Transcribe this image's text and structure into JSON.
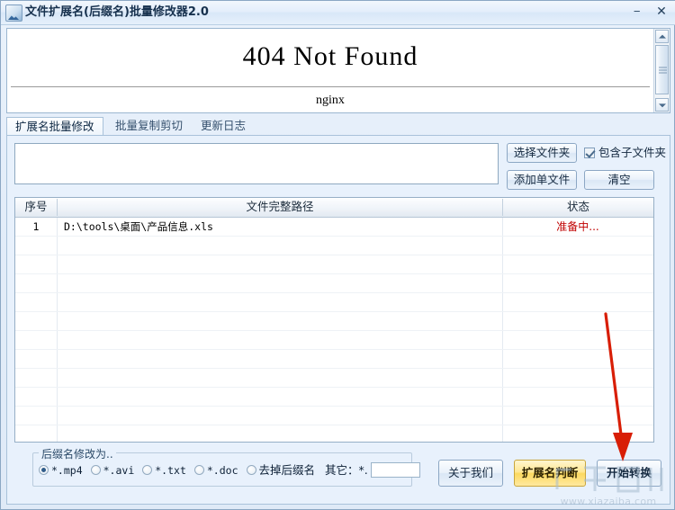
{
  "window": {
    "title": "文件扩展名(后缀名)批量修改器2.0",
    "icon": "picture-icon",
    "minimize_label": "−",
    "close_label": "✕"
  },
  "browser": {
    "heading": "404 Not Found",
    "server": "nginx",
    "scroll_up": "▲",
    "scroll_down": "▼"
  },
  "tabs": [
    {
      "label": "扩展名批量修改",
      "active": true
    },
    {
      "label": "批量复制剪切",
      "active": false
    },
    {
      "label": "更新日志",
      "active": false
    }
  ],
  "toolbar": {
    "path_value": "",
    "path_placeholder": "",
    "select_folder_label": "选择文件夹",
    "add_file_label": "添加单文件",
    "clear_label": "清空",
    "include_subfolders_label": "包含子文件夹",
    "include_subfolders_checked": true
  },
  "grid": {
    "columns": [
      "序号",
      "文件完整路径",
      "状态"
    ],
    "rows": [
      {
        "index": "1",
        "path": "D:\\tools\\桌面\\产品信息.xls",
        "status": "准备中..."
      }
    ],
    "status_color": "#c00000"
  },
  "options": {
    "group_label": "后缀名修改为..",
    "radios": [
      {
        "label": "*.mp4",
        "selected": true,
        "cn": false
      },
      {
        "label": "*.avi",
        "selected": false,
        "cn": false
      },
      {
        "label": "*.txt",
        "selected": false,
        "cn": false
      },
      {
        "label": "*.doc",
        "selected": false,
        "cn": false
      },
      {
        "label": "去掉后缀名",
        "selected": false,
        "cn": true
      }
    ],
    "other_label": "其它：*.",
    "other_value": ""
  },
  "actions": {
    "about_label": "关于我们",
    "judge_label": "扩展名判断",
    "start_label": "开始转换",
    "judge_color": "#fcd95f"
  },
  "overlay": {
    "arrow_color": "#d81e06",
    "watermark_text": "www.xiazaiba.com"
  }
}
